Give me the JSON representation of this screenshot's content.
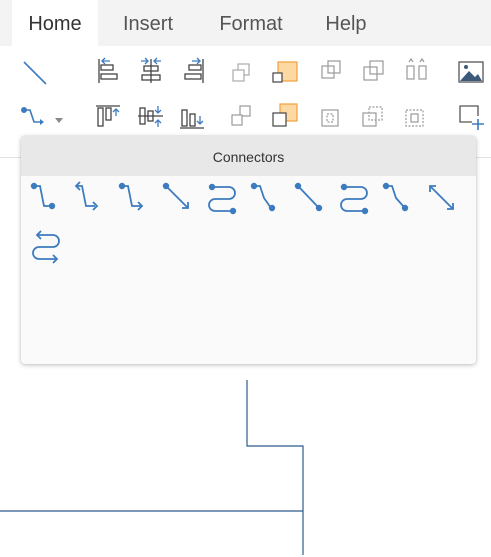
{
  "tabs": [
    {
      "label": "Home",
      "active": true
    },
    {
      "label": "Insert",
      "active": false
    },
    {
      "label": "Format",
      "active": false
    },
    {
      "label": "Help",
      "active": false
    }
  ],
  "ribbon": {
    "row1": [
      "straight-line-icon",
      "align-left-icon",
      "align-center-icon",
      "align-right-icon",
      "send-backward-icon",
      "bring-forward-icon",
      "group-icon",
      "ungroup-icon",
      "flip-icon",
      "insert-image-icon"
    ],
    "row2": [
      "connector-icon",
      "align-top-icon",
      "align-middle-icon",
      "align-bottom-icon",
      "send-to-back-icon",
      "bring-to-front-icon",
      "lock-icon",
      "unlock-icon",
      "select-icon",
      "add-shape-icon"
    ],
    "accent_color": "#3d7bbf",
    "highlight_fill": "#fbd8a4",
    "highlight_stroke": "#f2a23a"
  },
  "connectors_panel": {
    "title": "Connectors",
    "items": [
      "orthogonal-connector-icon",
      "orthogonal-connector-arrow-icon",
      "orthogonal-connector-double-arrow-icon",
      "straight-connector-icon",
      "curved-connector-icon",
      "orthogonal-connector-dot-icon",
      "straight-connector-dot-icon",
      "curved-connector-dot-icon",
      "orthogonal-connector-dot-arrow-icon",
      "straight-connector-double-arrow-icon",
      "curved-connector-double-arrow-icon"
    ]
  }
}
